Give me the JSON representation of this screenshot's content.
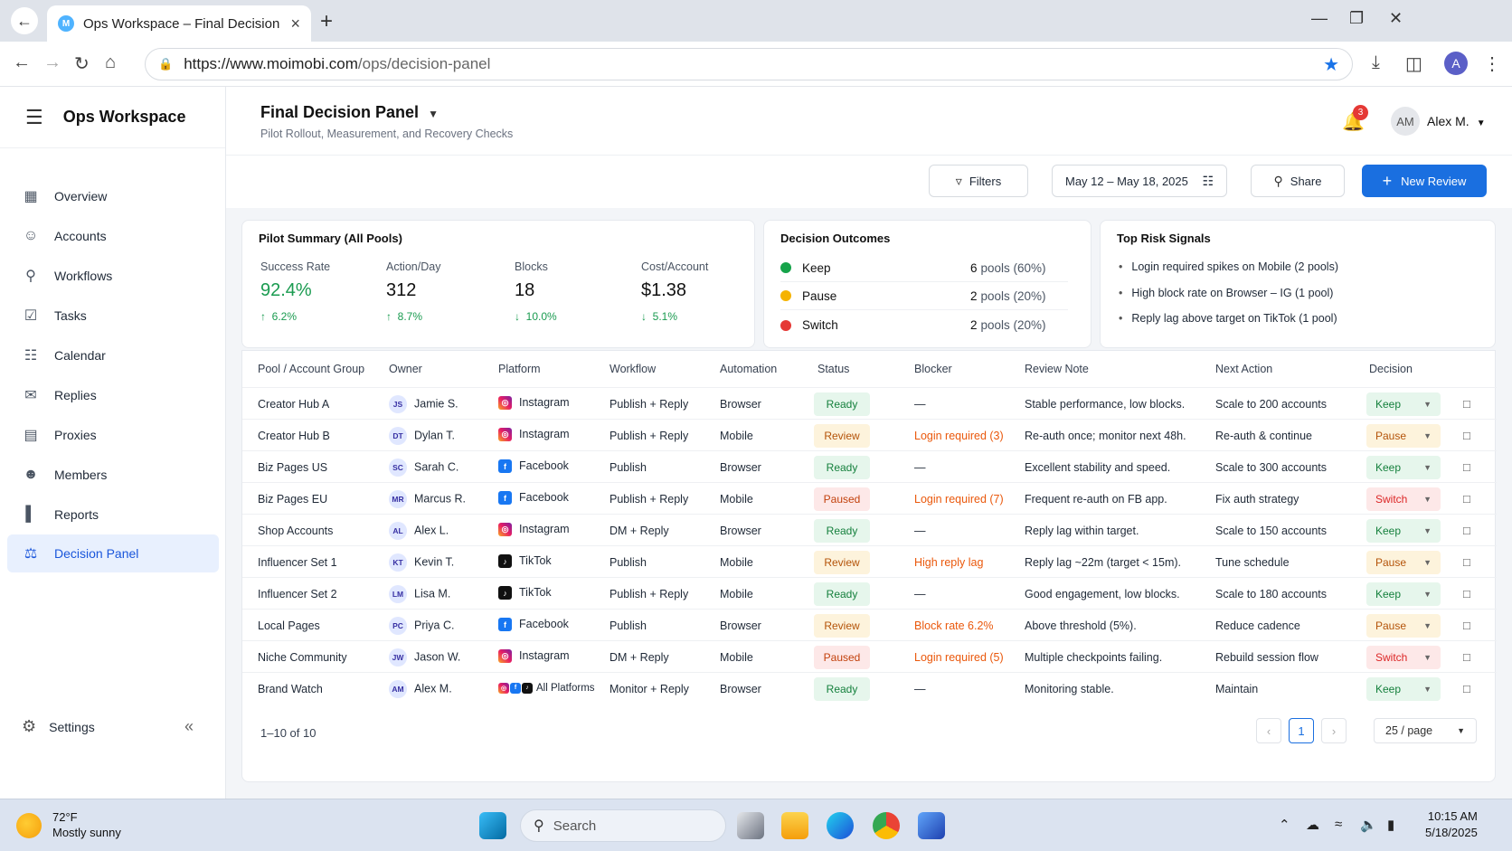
{
  "browser": {
    "tab_title": "Ops Workspace – Final Decision",
    "tab_favicon": "M",
    "url_host": "https://www.moimobi.com",
    "url_path": "/ops/decision-panel",
    "profile_initial": "A"
  },
  "sidebar": {
    "workspace_title": "Ops Workspace",
    "items": [
      {
        "label": "Overview",
        "icon": "grid-icon"
      },
      {
        "label": "Accounts",
        "icon": "users-icon"
      },
      {
        "label": "Workflows",
        "icon": "share-nodes-icon"
      },
      {
        "label": "Tasks",
        "icon": "checkbox-icon"
      },
      {
        "label": "Calendar",
        "icon": "calendar-icon"
      },
      {
        "label": "Replies",
        "icon": "chat-icon"
      },
      {
        "label": "Proxies",
        "icon": "server-icon"
      },
      {
        "label": "Members",
        "icon": "members-icon"
      },
      {
        "label": "Reports",
        "icon": "bar-chart-icon"
      },
      {
        "label": "Decision Panel",
        "icon": "scale-icon",
        "active": true
      }
    ],
    "settings_label": "Settings"
  },
  "header": {
    "title": "Final Decision Panel",
    "subtitle": "Pilot Rollout, Measurement, and Recovery Checks",
    "notification_count": "3",
    "user_initials": "AM",
    "user_name": "Alex M."
  },
  "toolbar": {
    "filters_label": "Filters",
    "date_range": "May 12 – May 18, 2025",
    "share_label": "Share",
    "new_review_label": "New Review"
  },
  "summary": {
    "title": "Pilot Summary (All Pools)",
    "kpis": [
      {
        "label": "Success Rate",
        "value": "92.4%",
        "delta": "6.2%",
        "direction": "up"
      },
      {
        "label": "Action/Day",
        "value": "312",
        "delta": "8.7%",
        "direction": "up"
      },
      {
        "label": "Blocks",
        "value": "18",
        "delta": "10.0%",
        "direction": "down"
      },
      {
        "label": "Cost/Account",
        "value": "$1.38",
        "delta": "5.1%",
        "direction": "down"
      }
    ]
  },
  "outcomes": {
    "title": "Decision Outcomes",
    "rows": [
      {
        "label": "Keep",
        "count": "6",
        "pct": "pools (60%)",
        "color": "#16a34a"
      },
      {
        "label": "Pause",
        "count": "2",
        "pct": "pools (20%)",
        "color": "#f5b301"
      },
      {
        "label": "Switch",
        "count": "2",
        "pct": "pools (20%)",
        "color": "#e53935"
      }
    ]
  },
  "risks": {
    "title": "Top Risk Signals",
    "items": [
      "Login required spikes on Mobile (2 pools)",
      "High block rate on Browser – IG (1 pool)",
      "Reply lag above target on TikTok (1 pool)"
    ]
  },
  "table": {
    "headers": [
      "Pool / Account Group",
      "Owner",
      "Platform",
      "Workflow",
      "Automation",
      "Status",
      "Blocker",
      "Review Note",
      "Next Action",
      "Decision"
    ],
    "rows": [
      {
        "pool": "Creator Hub A",
        "initials": "JS",
        "owner": "Jamie S.",
        "platform": "Instagram",
        "pf": "ig",
        "workflow": "Publish + Reply",
        "automation": "Browser",
        "status": "Ready",
        "blocker": "—",
        "note": "Stable performance, low blocks.",
        "next": "Scale to 200 accounts",
        "decision": "Keep"
      },
      {
        "pool": "Creator Hub B",
        "initials": "DT",
        "owner": "Dylan T.",
        "platform": "Instagram",
        "pf": "ig",
        "workflow": "Publish + Reply",
        "automation": "Mobile",
        "status": "Review",
        "blocker": "Login required (3)",
        "note": "Re-auth once; monitor next 48h.",
        "next": "Re-auth & continue",
        "decision": "Pause"
      },
      {
        "pool": "Biz Pages US",
        "initials": "SC",
        "owner": "Sarah C.",
        "platform": "Facebook",
        "pf": "fb",
        "workflow": "Publish",
        "automation": "Browser",
        "status": "Ready",
        "blocker": "—",
        "note": "Excellent stability and speed.",
        "next": "Scale to 300 accounts",
        "decision": "Keep"
      },
      {
        "pool": "Biz Pages EU",
        "initials": "MR",
        "owner": "Marcus R.",
        "platform": "Facebook",
        "pf": "fb",
        "workflow": "Publish + Reply",
        "automation": "Mobile",
        "status": "Paused",
        "blocker": "Login required (7)",
        "note": "Frequent re-auth on FB app.",
        "next": "Fix auth strategy",
        "decision": "Switch"
      },
      {
        "pool": "Shop Accounts",
        "initials": "AL",
        "owner": "Alex L.",
        "platform": "Instagram",
        "pf": "ig",
        "workflow": "DM + Reply",
        "automation": "Browser",
        "status": "Ready",
        "blocker": "—",
        "note": "Reply lag within target.",
        "next": "Scale to 150 accounts",
        "decision": "Keep"
      },
      {
        "pool": "Influencer Set 1",
        "initials": "KT",
        "owner": "Kevin T.",
        "platform": "TikTok",
        "pf": "tt",
        "workflow": "Publish",
        "automation": "Mobile",
        "status": "Review",
        "blocker": "High reply lag",
        "note": "Reply lag ~22m (target < 15m).",
        "next": "Tune schedule",
        "decision": "Pause"
      },
      {
        "pool": "Influencer Set 2",
        "initials": "LM",
        "owner": "Lisa M.",
        "platform": "TikTok",
        "pf": "tt",
        "workflow": "Publish + Reply",
        "automation": "Mobile",
        "status": "Ready",
        "blocker": "—",
        "note": "Good engagement, low blocks.",
        "next": "Scale to 180 accounts",
        "decision": "Keep"
      },
      {
        "pool": "Local Pages",
        "initials": "PC",
        "owner": "Priya C.",
        "platform": "Facebook",
        "pf": "fb",
        "workflow": "Publish",
        "automation": "Browser",
        "status": "Review",
        "blocker": "Block rate 6.2%",
        "note": "Above threshold (5%).",
        "next": "Reduce cadence",
        "decision": "Pause"
      },
      {
        "pool": "Niche Community",
        "initials": "JW",
        "owner": "Jason W.",
        "platform": "Instagram",
        "pf": "ig",
        "workflow": "DM + Reply",
        "automation": "Mobile",
        "status": "Paused",
        "blocker": "Login required (5)",
        "note": "Multiple checkpoints failing.",
        "next": "Rebuild session flow",
        "decision": "Switch"
      },
      {
        "pool": "Brand Watch",
        "initials": "AM",
        "owner": "Alex M.",
        "platform": "All Platforms",
        "pf": "all",
        "workflow": "Monitor + Reply",
        "automation": "Browser",
        "status": "Ready",
        "blocker": "—",
        "note": "Monitoring stable.",
        "next": "Maintain",
        "decision": "Keep"
      }
    ],
    "range_text": "1–10 of 10",
    "current_page": "1",
    "per_page": "25 / page"
  },
  "taskbar": {
    "temp": "72°F",
    "condition": "Mostly sunny",
    "search_placeholder": "Search",
    "time": "10:15 AM",
    "date": "5/18/2025"
  }
}
